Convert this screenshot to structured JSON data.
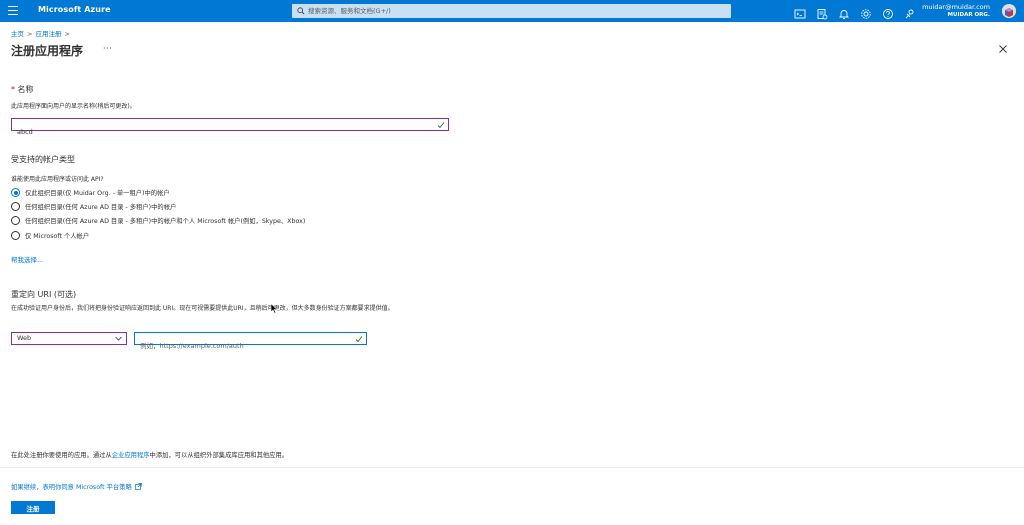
{
  "topbar": {
    "brand": "Microsoft Azure",
    "search_placeholder": "搜索资源、服务和文档(G+/)",
    "account_email": "muidar@muidar.com",
    "account_org": "MUIDAR ORG.",
    "icons": [
      "cloud-shell-icon",
      "directory-filter-icon",
      "notifications-icon",
      "settings-icon",
      "help-icon",
      "feedback-icon"
    ]
  },
  "breadcrumb": [
    "主页",
    "应用注册"
  ],
  "page": {
    "title": "注册应用程序",
    "more": "···"
  },
  "name_section": {
    "heading": "名称",
    "required_mark": "*",
    "description": "此应用程序面向用户的显示名称(稍后可更改)。",
    "value": "abcd"
  },
  "account_section": {
    "heading": "受支持的帐户类型",
    "question": "谁能使用此应用程序或访问此 API?",
    "options": [
      {
        "label": "仅此组织目录(仅 Muidar Org. - 单一租户)中的帐户",
        "selected": true
      },
      {
        "label": "任何组织目录(任何 Azure AD 目录 - 多租户)中的帐户",
        "selected": false
      },
      {
        "label": "任何组织目录(任何 Azure AD 目录 - 多租户)中的帐户和个人 Microsoft 帐户(例如，Skype、Xbox)",
        "selected": false
      },
      {
        "label": "仅 Microsoft 个人帐户",
        "selected": false
      }
    ],
    "help_link": "帮我选择..."
  },
  "redirect_section": {
    "heading": "重定向 URI (可选)",
    "description": "在成功验证用户身份后，我们将把身份验证响应返回到此 URI。现在可视需要提供此URI，且稍后可更改，但大多数身份验证方案都要求提供值。",
    "platform": "Web",
    "uri_placeholder": "例如，https://example.com/auth"
  },
  "footer": {
    "note_prefix": "在此处注册你要使用的应用。通过从",
    "note_link": "企业应用程序",
    "note_suffix": "中添加，可以从组织外部集成库应用和其他应用。",
    "policy_link": "如果继续，表明你同意 Microsoft 平台策略",
    "register_label": "注册"
  },
  "colors": {
    "accent": "#0078d4",
    "topbar": "#0078d4",
    "valid_border": "#8a2d9e",
    "valid_check": "#107c10"
  }
}
